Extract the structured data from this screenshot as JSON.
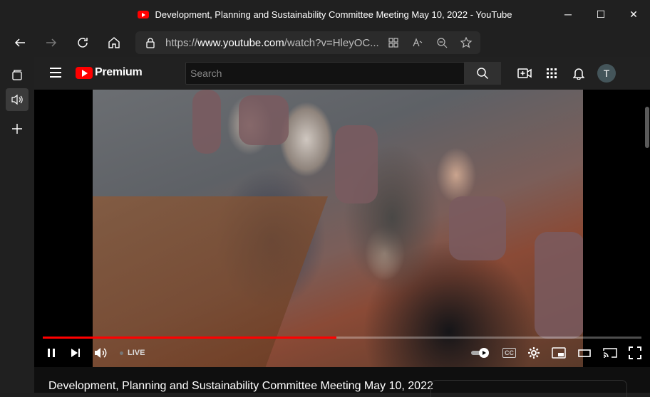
{
  "window": {
    "title": "Development, Planning and Sustainability Committee Meeting May 10, 2022 - YouTube",
    "minimize": "─",
    "maximize": "☐",
    "close": "✕"
  },
  "address_bar": {
    "scheme": "https://",
    "domain": "www.youtube.com",
    "path": "/watch?v=HleyOC..."
  },
  "youtube": {
    "brand": "Premium",
    "search_placeholder": "Search",
    "avatar_letter": "T"
  },
  "player": {
    "live_label": "LIVE",
    "progress_fraction": 0.49,
    "cc_label": "CC"
  },
  "video": {
    "title": "Development, Planning and Sustainability Committee Meeting May 10, 2022"
  },
  "icons": [
    "youtube-icon",
    "back-icon",
    "forward-icon",
    "refresh-icon",
    "home-icon",
    "lock-icon",
    "apps-icon",
    "read-aloud-icon",
    "zoom-icon",
    "favorite-add-icon",
    "favorites-icon",
    "collections-icon",
    "extensions-icon",
    "profile-icon",
    "more-icon",
    "tab-actions-icon",
    "audio-icon",
    "add-icon",
    "menu-icon",
    "search-icon",
    "create-icon",
    "apps-grid-icon",
    "bell-icon",
    "pause-icon",
    "next-icon",
    "volume-icon",
    "autoplay-icon",
    "captions-icon",
    "settings-icon",
    "miniplayer-icon",
    "theater-icon",
    "cast-icon",
    "fullscreen-icon"
  ]
}
